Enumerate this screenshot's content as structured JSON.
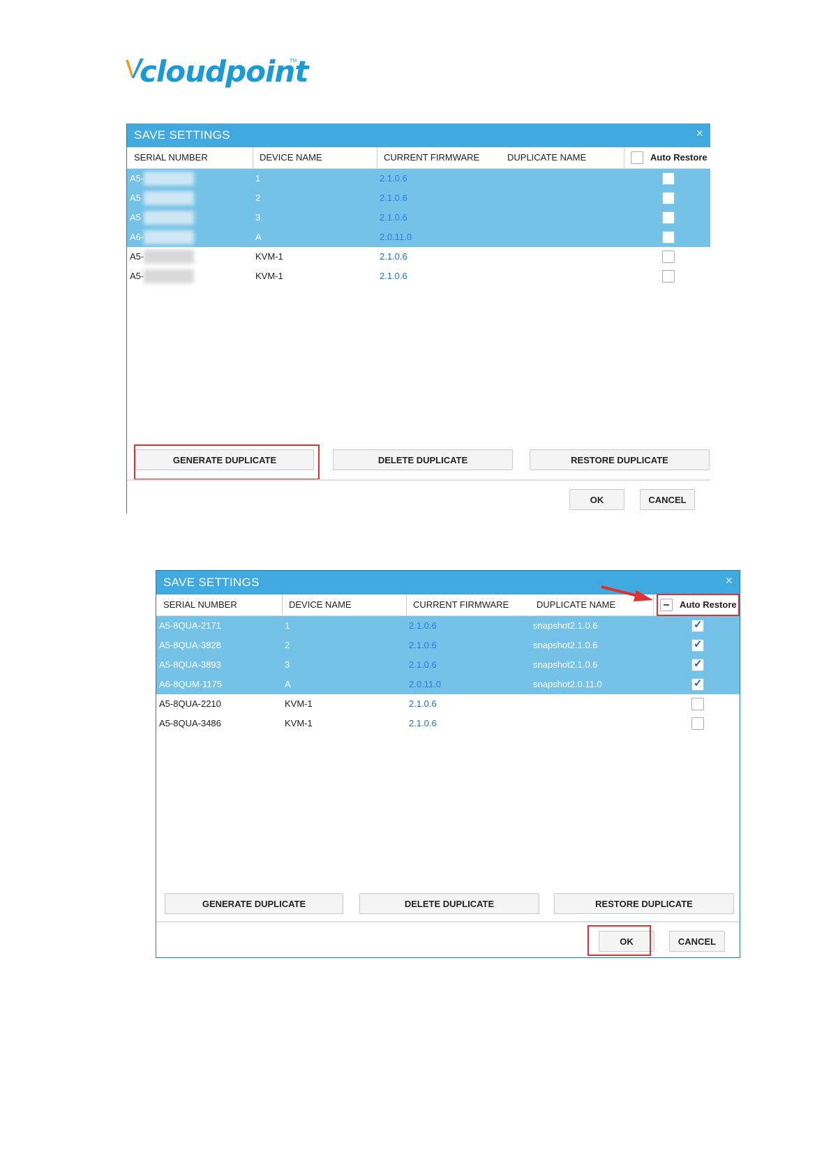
{
  "logo": {
    "text": "cloudpoint",
    "tm": "TM"
  },
  "dialog1": {
    "title": "SAVE SETTINGS",
    "close": "×",
    "columns": [
      "SERIAL NUMBER",
      "DEVICE NAME",
      "CURRENT FIRMWARE",
      "DUPLICATE NAME"
    ],
    "auto_restore": "Auto Restore",
    "rows": [
      {
        "serial": "A5-",
        "device": "1",
        "firmware": "2.1.0.6",
        "duplicate": "",
        "checked": false
      },
      {
        "serial": "A5",
        "device": "2",
        "firmware": "2.1.0.6",
        "duplicate": "",
        "checked": false
      },
      {
        "serial": "A5",
        "device": "3",
        "firmware": "2.1.0.6",
        "duplicate": "",
        "checked": false
      },
      {
        "serial": "A6-",
        "device": "A",
        "firmware": "2.0.11.0",
        "duplicate": "",
        "checked": false
      },
      {
        "serial": "A5-",
        "device": "KVM-1",
        "firmware": "2.1.0.6",
        "duplicate": "",
        "checked": false
      },
      {
        "serial": "A5-",
        "device": "KVM-1",
        "firmware": "2.1.0.6",
        "duplicate": "",
        "checked": false
      }
    ],
    "buttons": {
      "generate": "GENERATE DUPLICATE",
      "delete": "DELETE DUPLICATE",
      "restore": "RESTORE DUPLICATE",
      "ok": "OK",
      "cancel": "CANCEL"
    }
  },
  "dialog2": {
    "title": "SAVE SETTINGS",
    "close": "×",
    "columns": [
      "SERIAL NUMBER",
      "DEVICE NAME",
      "CURRENT FIRMWARE",
      "DUPLICATE NAME"
    ],
    "auto_restore": "Auto Restore",
    "rows": [
      {
        "serial": "A5-8QUA-2171",
        "device": "1",
        "firmware": "2.1.0.6",
        "duplicate": "snapshot2.1.0.6",
        "checked": true
      },
      {
        "serial": "A5-8QUA-3828",
        "device": "2",
        "firmware": "2.1.0.6",
        "duplicate": "snapshot2.1.0.6",
        "checked": true
      },
      {
        "serial": "A5-8QUA-3893",
        "device": "3",
        "firmware": "2.1.0.6",
        "duplicate": "snapshot2.1.0.6",
        "checked": true
      },
      {
        "serial": "A6-8QUM-1175",
        "device": "A",
        "firmware": "2.0.11.0",
        "duplicate": "snapshot2.0.11.0",
        "checked": true
      },
      {
        "serial": "A5-8QUA-2210",
        "device": "KVM-1",
        "firmware": "2.1.0.6",
        "duplicate": "",
        "checked": false
      },
      {
        "serial": "A5-8QUA-3486",
        "device": "KVM-1",
        "firmware": "2.1.0.6",
        "duplicate": "",
        "checked": false
      }
    ],
    "buttons": {
      "generate": "GENERATE DUPLICATE",
      "delete": "DELETE DUPLICATE",
      "restore": "RESTORE DUPLICATE",
      "ok": "OK",
      "cancel": "CANCEL"
    }
  },
  "colors": {
    "titlebar": "#3fa9e0",
    "selected_row": "#74c2e8",
    "firmware_text": "#1d6fe0",
    "highlight": "#e03030"
  }
}
